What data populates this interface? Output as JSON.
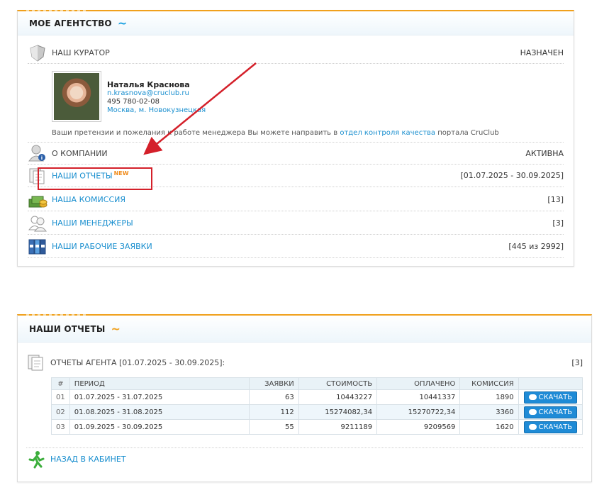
{
  "agency_panel": {
    "title": "МОЕ АГЕНТСТВО",
    "curator": {
      "label": "НАШ КУРАТОР",
      "status": "НАЗНАЧЕН",
      "name": "Наталья Краснова",
      "email": "n.krasnova@cruclub.ru",
      "phone": "495 780-02-08",
      "location": "Москва, м. Новокузнецкая"
    },
    "note": {
      "text": "Ваши претензии и пожелания к работе менеджера Вы можете направить в ",
      "link": "отдел контроля качества",
      "suffix": " портала CruClub"
    },
    "rows": [
      {
        "label": "О КОМПАНИИ",
        "right": "АКТИВНА",
        "icon": "user-info-icon"
      },
      {
        "label": "НАШИ ОТЧЕТЫ",
        "badge": "NEW",
        "right": "[01.07.2025 - 30.09.2025]",
        "icon": "documents-icon"
      },
      {
        "label": "НАША КОМИССИЯ",
        "right": "[13]",
        "icon": "money-icon"
      },
      {
        "label": "НАШИ МЕНЕДЖЕРЫ",
        "right": "[3]",
        "icon": "users-icon"
      },
      {
        "label": "НАШИ РАБОЧИЕ ЗАЯВКИ",
        "right": "[445 из 2992]",
        "icon": "binders-icon"
      }
    ]
  },
  "reports_panel": {
    "title": "НАШИ ОТЧЕТЫ",
    "section_label": "ОТЧЕТЫ АГЕНТА [01.07.2025 - 30.09.2025]:",
    "section_count": "[3]",
    "columns": [
      "#",
      "ПЕРИОД",
      "ЗАЯВКИ",
      "СТОИМОСТЬ",
      "ОПЛАЧЕНО",
      "КОМИССИЯ",
      ""
    ],
    "rows": [
      {
        "idx": "01",
        "period": "01.07.2025 - 31.07.2025",
        "orders": "63",
        "cost": "10443227",
        "paid": "10441337",
        "commission": "1890",
        "button": "СКАЧАТЬ"
      },
      {
        "idx": "02",
        "period": "01.08.2025 - 31.08.2025",
        "orders": "112",
        "cost": "15274082,34",
        "paid": "15270722,34",
        "commission": "3360",
        "button": "СКАЧАТЬ"
      },
      {
        "idx": "03",
        "period": "01.09.2025 - 30.09.2025",
        "orders": "55",
        "cost": "9211189",
        "paid": "9209569",
        "commission": "1620",
        "button": "СКАЧАТЬ"
      }
    ],
    "back_label": "НАЗАД В КАБИНЕТ"
  },
  "colors": {
    "accent": "#f0a01c",
    "link": "#1a8fcf",
    "highlight": "#d4202a"
  }
}
